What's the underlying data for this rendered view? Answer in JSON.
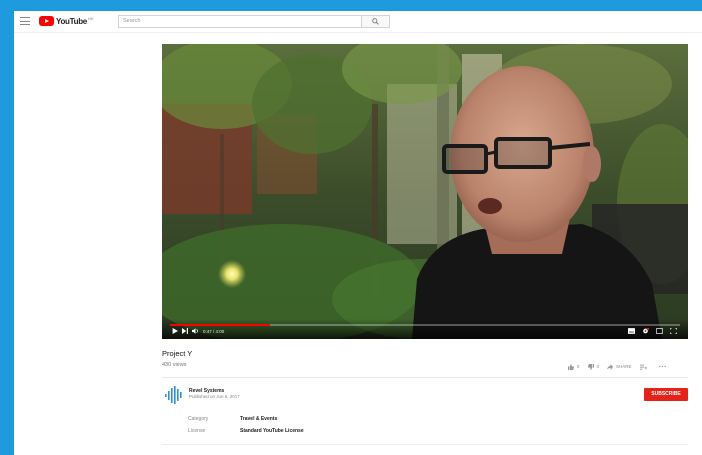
{
  "masthead": {
    "logo_text": "YouTube",
    "logo_region": "HK",
    "search_placeholder": "Search"
  },
  "player": {
    "current_time": "0:47 / 4:00",
    "progress_fraction": 0.196
  },
  "video": {
    "title": "Project Y",
    "views": "430 views",
    "likes": "0",
    "dislikes": "0",
    "share_label": "SHARE"
  },
  "channel": {
    "name": "Revel Systems",
    "published": "Published on Jun 6, 2017",
    "subscribe_label": "SUBSCRIBE"
  },
  "metadata": [
    {
      "key": "Category",
      "value": "Travel & Events"
    },
    {
      "key": "License",
      "value": "Standard YouTube License"
    }
  ],
  "colors": {
    "accent": "#ff0000",
    "subscribe": "#e62117",
    "background": "#1e9bde"
  }
}
